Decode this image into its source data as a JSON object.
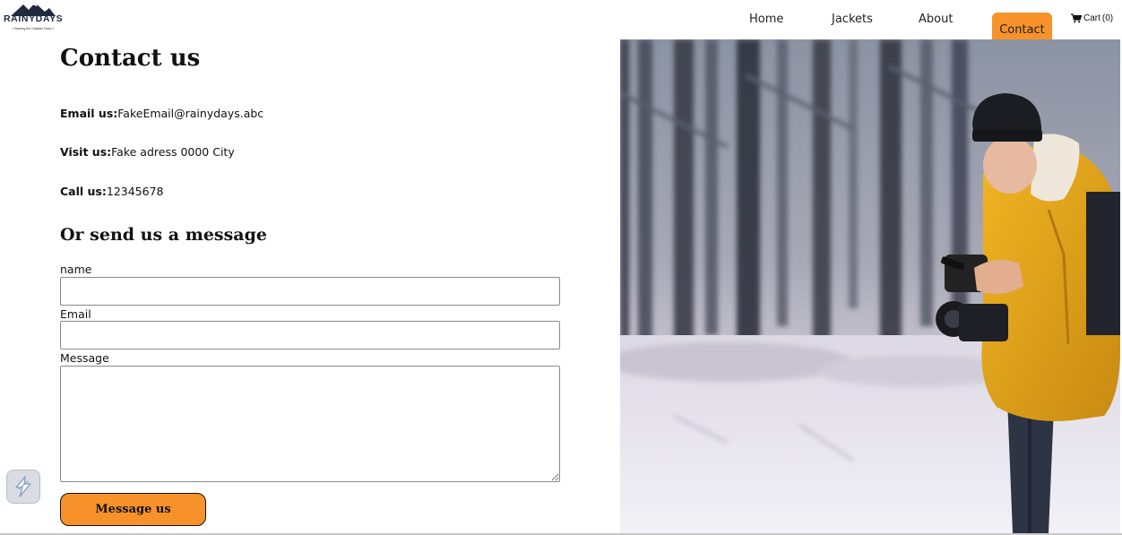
{
  "brand": {
    "name": "RAINYDAYS",
    "tagline": "« Braving the Outside! Deep »"
  },
  "nav": {
    "items": [
      {
        "label": "Home"
      },
      {
        "label": "Jackets"
      },
      {
        "label": "About"
      },
      {
        "label": "Contact"
      }
    ],
    "active": "Contact",
    "cart_label": "Cart",
    "cart_count": "(0)"
  },
  "page": {
    "title": "Contact us",
    "email_label": "Email us:",
    "email_value": "FakeEmail@rainydays.abc",
    "visit_label": "Visit us:",
    "visit_value": "Fake adress 0000 City",
    "call_label": "Call us:",
    "call_value": "12345678"
  },
  "form": {
    "heading": "Or send us a message",
    "name_label": "name",
    "email_label": "Email",
    "message_label": "Message",
    "submit_label": "Message us"
  },
  "colors": {
    "accent": "#f7922b",
    "text": "#111111"
  },
  "icons": {
    "cart": "cart-icon",
    "widget": "lightning-widget-icon"
  }
}
